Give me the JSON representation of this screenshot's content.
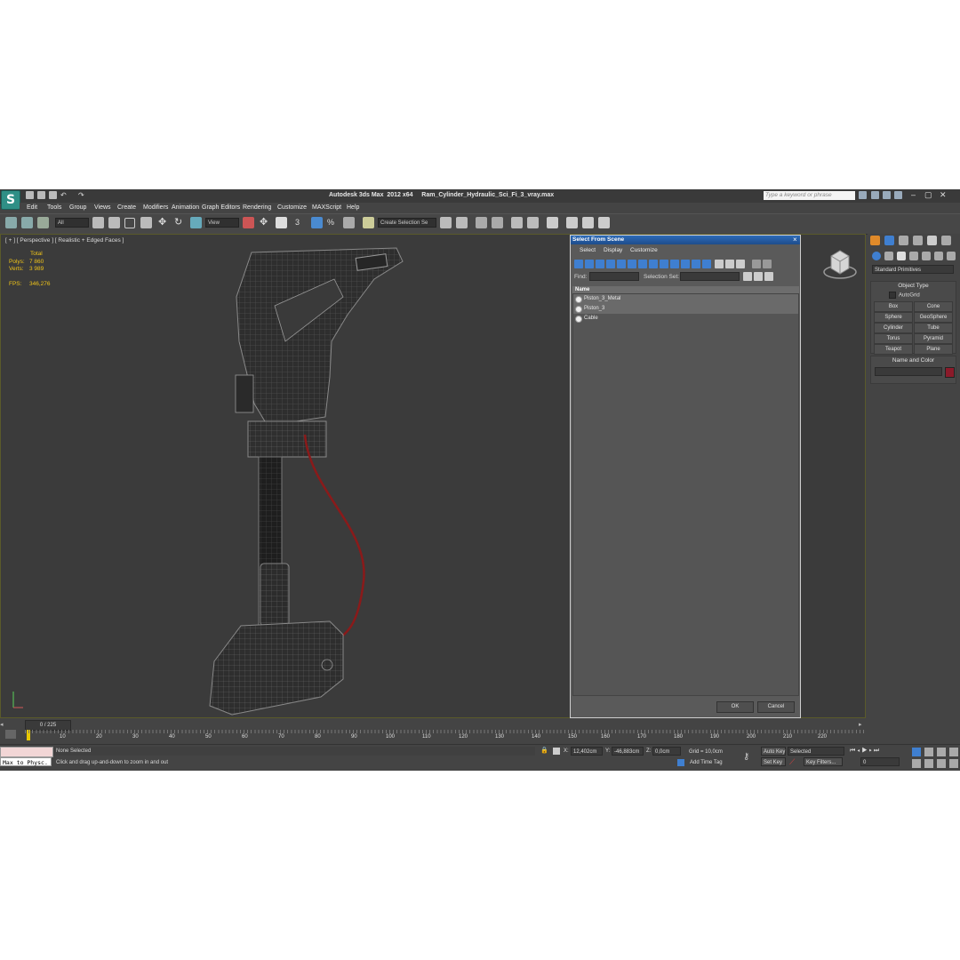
{
  "app": {
    "logo_glyph": "S",
    "title": "Autodesk 3ds Max  2012 x64     Ram_Cylinder_Hydraulic_Sci_Fi_3_vray.max",
    "search_placeholder": "Type a keyword or phrase"
  },
  "menu": [
    "Edit",
    "Tools",
    "Group",
    "Views",
    "Create",
    "Modifiers",
    "Animation",
    "Graph Editors",
    "Rendering",
    "Customize",
    "MAXScript",
    "Help"
  ],
  "toolbar": {
    "filter_value": "All",
    "refcoord_value": "View",
    "selection_set_value": "Create Selection Se",
    "snap_label": "3",
    "percent_label": "%"
  },
  "viewport": {
    "label": "[ + ] [ Perspective ] [ Realistic + Edged Faces ]",
    "stats": {
      "total_label": "Total",
      "polys_label": "Polys:",
      "polys_value": "7 860",
      "verts_label": "Verts:",
      "verts_value": "3 989",
      "fps_label": "FPS:",
      "fps_value": "346,276"
    }
  },
  "dialog": {
    "title": "Select From Scene",
    "menu": [
      "Select",
      "Display",
      "Customize"
    ],
    "find_label": "Find:",
    "selection_set_label": "Selection Set:",
    "list_header": "Name",
    "items": [
      "Piston_3_Metal",
      "Piston_3",
      "Cable"
    ],
    "ok_label": "OK",
    "cancel_label": "Cancel"
  },
  "command_panel": {
    "category_value": "Standard Primitives",
    "object_type_title": "Object Type",
    "autogrid_label": "AutoGrid",
    "buttons": [
      "Box",
      "Cone",
      "Sphere",
      "GeoSphere",
      "Cylinder",
      "Tube",
      "Torus",
      "Pyramid",
      "Teapot",
      "Plane"
    ],
    "name_color_title": "Name and Color",
    "swatch_color": "#8b1a2a"
  },
  "timeline": {
    "frame_label": "0 / 225",
    "ticks": [
      "10",
      "20",
      "30",
      "40",
      "50",
      "60",
      "70",
      "80",
      "90",
      "100",
      "110",
      "120",
      "130",
      "140",
      "150",
      "160",
      "170",
      "180",
      "190",
      "200",
      "210",
      "220"
    ]
  },
  "status": {
    "maxscript_label": "Max to Physc.",
    "selection_status": "None Selected",
    "prompt": "Click and drag up-and-down to zoom in and out",
    "x_label": "X:",
    "x_value": "12,402cm",
    "y_label": "Y:",
    "y_value": "-46,883cm",
    "z_label": "Z:",
    "z_value": "0,0cm",
    "grid_label": "Grid = 10,0cm",
    "add_time_tag": "Add Time Tag",
    "auto_key": "Auto Key",
    "set_key": "Set Key",
    "key_mode_value": "Selected",
    "key_filters": "Key Filters...",
    "frame_value": "0"
  }
}
